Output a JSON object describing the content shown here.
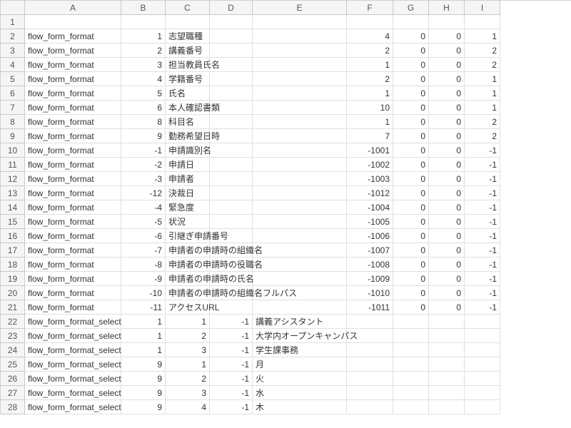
{
  "columns": [
    "",
    "A",
    "B",
    "C",
    "D",
    "E",
    "F",
    "G",
    "H",
    "I"
  ],
  "rows": [
    {
      "n": "1",
      "cells": [
        "",
        "",
        "",
        "",
        "",
        "",
        "",
        "",
        ""
      ]
    },
    {
      "n": "2",
      "cells": [
        "flow_form_format",
        "1",
        "志望職種",
        "",
        "",
        "4",
        "0",
        "0",
        "1"
      ]
    },
    {
      "n": "3",
      "cells": [
        "flow_form_format",
        "2",
        "講義番号",
        "",
        "",
        "2",
        "0",
        "0",
        "2"
      ]
    },
    {
      "n": "4",
      "cells": [
        "flow_form_format",
        "3",
        "担当教員氏名",
        "",
        "",
        "1",
        "0",
        "0",
        "2"
      ]
    },
    {
      "n": "5",
      "cells": [
        "flow_form_format",
        "4",
        "学籍番号",
        "",
        "",
        "2",
        "0",
        "0",
        "1"
      ]
    },
    {
      "n": "6",
      "cells": [
        "flow_form_format",
        "5",
        "氏名",
        "",
        "",
        "1",
        "0",
        "0",
        "1"
      ]
    },
    {
      "n": "7",
      "cells": [
        "flow_form_format",
        "6",
        "本人確認書類",
        "",
        "",
        "10",
        "0",
        "0",
        "1"
      ]
    },
    {
      "n": "8",
      "cells": [
        "flow_form_format",
        "8",
        "科目名",
        "",
        "",
        "1",
        "0",
        "0",
        "2"
      ]
    },
    {
      "n": "9",
      "cells": [
        "flow_form_format",
        "9",
        "勤務希望日時",
        "",
        "",
        "7",
        "0",
        "0",
        "2"
      ]
    },
    {
      "n": "10",
      "cells": [
        "flow_form_format",
        "-1",
        "申請識別名",
        "",
        "",
        "-1001",
        "0",
        "0",
        "-1"
      ]
    },
    {
      "n": "11",
      "cells": [
        "flow_form_format",
        "-2",
        "申請日",
        "",
        "",
        "-1002",
        "0",
        "0",
        "-1"
      ]
    },
    {
      "n": "12",
      "cells": [
        "flow_form_format",
        "-3",
        "申請者",
        "",
        "",
        "-1003",
        "0",
        "0",
        "-1"
      ]
    },
    {
      "n": "13",
      "cells": [
        "flow_form_format",
        "-12",
        "決裁日",
        "",
        "",
        "-1012",
        "0",
        "0",
        "-1"
      ]
    },
    {
      "n": "14",
      "cells": [
        "flow_form_format",
        "-4",
        "緊急度",
        "",
        "",
        "-1004",
        "0",
        "0",
        "-1"
      ]
    },
    {
      "n": "15",
      "cells": [
        "flow_form_format",
        "-5",
        "状況",
        "",
        "",
        "-1005",
        "0",
        "0",
        "-1"
      ]
    },
    {
      "n": "16",
      "cells": [
        "flow_form_format",
        "-6",
        "引継ぎ申請番号",
        "",
        "",
        "-1006",
        "0",
        "0",
        "-1"
      ]
    },
    {
      "n": "17",
      "cells": [
        "flow_form_format",
        "-7",
        "申請者の申請時の組織名",
        "",
        "",
        "-1007",
        "0",
        "0",
        "-1"
      ]
    },
    {
      "n": "18",
      "cells": [
        "flow_form_format",
        "-8",
        "申請者の申請時の役職名",
        "",
        "",
        "-1008",
        "0",
        "0",
        "-1"
      ]
    },
    {
      "n": "19",
      "cells": [
        "flow_form_format",
        "-9",
        "申請者の申請時の氏名",
        "",
        "",
        "-1009",
        "0",
        "0",
        "-1"
      ]
    },
    {
      "n": "20",
      "cells": [
        "flow_form_format",
        "-10",
        "申請者の申請時の組織名フルパス",
        "",
        "",
        "-1010",
        "0",
        "0",
        "-1"
      ]
    },
    {
      "n": "21",
      "cells": [
        "flow_form_format",
        "-11",
        "アクセスURL",
        "",
        "",
        "-1011",
        "0",
        "0",
        "-1"
      ]
    },
    {
      "n": "22",
      "cells": [
        "flow_form_format_select",
        "1",
        "1",
        "-1",
        "講義アシスタント",
        "",
        "",
        "",
        ""
      ]
    },
    {
      "n": "23",
      "cells": [
        "flow_form_format_select",
        "1",
        "2",
        "-1",
        "大学内オープンキャンパス",
        "",
        "",
        "",
        ""
      ]
    },
    {
      "n": "24",
      "cells": [
        "flow_form_format_select",
        "1",
        "3",
        "-1",
        "学生課事務",
        "",
        "",
        "",
        ""
      ]
    },
    {
      "n": "25",
      "cells": [
        "flow_form_format_select",
        "9",
        "1",
        "-1",
        "月",
        "",
        "",
        "",
        ""
      ]
    },
    {
      "n": "26",
      "cells": [
        "flow_form_format_select",
        "9",
        "2",
        "-1",
        "火",
        "",
        "",
        "",
        ""
      ]
    },
    {
      "n": "27",
      "cells": [
        "flow_form_format_select",
        "9",
        "3",
        "-1",
        "水",
        "",
        "",
        "",
        ""
      ]
    },
    {
      "n": "28",
      "cells": [
        "flow_form_format_select",
        "9",
        "4",
        "-1",
        "木",
        "",
        "",
        "",
        ""
      ]
    }
  ],
  "numeric_cols_upper": [
    1,
    5,
    6,
    7,
    8
  ],
  "numeric_cols_lower": [
    1,
    2,
    3
  ]
}
